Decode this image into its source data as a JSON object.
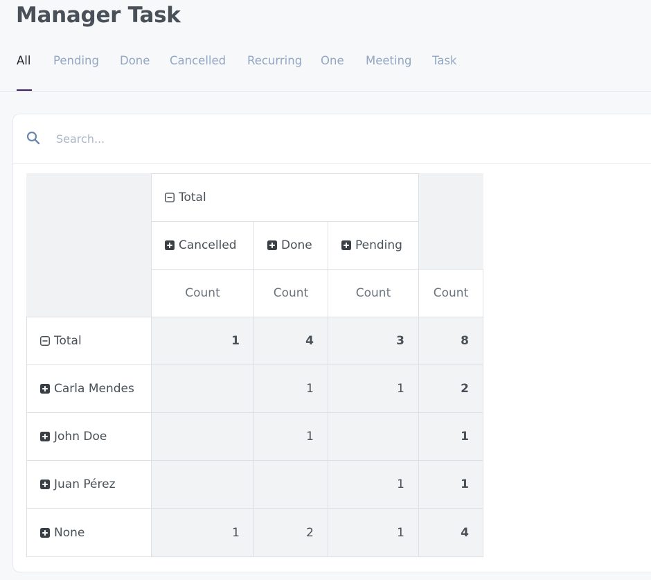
{
  "page": {
    "title": "Manager Task"
  },
  "tabs": [
    {
      "label": "All",
      "active": true
    },
    {
      "label": "Pending"
    },
    {
      "label": "Done"
    },
    {
      "label": "Cancelled"
    },
    {
      "label": "Recurring"
    },
    {
      "label": "One"
    },
    {
      "label": "Meeting"
    },
    {
      "label": "Task"
    }
  ],
  "search": {
    "placeholder": "Search...",
    "value": ""
  },
  "pivot": {
    "column_header": {
      "label": "Total",
      "icon": "minus-square-icon"
    },
    "columns": [
      {
        "label": "Cancelled",
        "icon": "plus-square-icon"
      },
      {
        "label": "Done",
        "icon": "plus-square-icon"
      },
      {
        "label": "Pending",
        "icon": "plus-square-icon"
      }
    ],
    "measure_label": "Count",
    "rows": [
      {
        "label": "Total",
        "icon": "minus-square-icon",
        "values": [
          "1",
          "4",
          "3"
        ],
        "total": "8"
      },
      {
        "label": "Carla Mendes",
        "icon": "plus-square-icon",
        "values": [
          "",
          "1",
          "1"
        ],
        "total": "2"
      },
      {
        "label": "John Doe",
        "icon": "plus-square-icon",
        "values": [
          "",
          "1",
          ""
        ],
        "total": "1"
      },
      {
        "label": "Juan Pérez",
        "icon": "plus-square-icon",
        "values": [
          "",
          "",
          "1"
        ],
        "total": "1"
      },
      {
        "label": "None",
        "icon": "plus-square-icon",
        "values": [
          "1",
          "2",
          "1"
        ],
        "total": "4"
      }
    ]
  },
  "colors": {
    "accent": "#3b1d6e",
    "tab_inactive": "#93a7c4",
    "cell_background": "#f2f3f5",
    "border": "#dcdfe4"
  }
}
